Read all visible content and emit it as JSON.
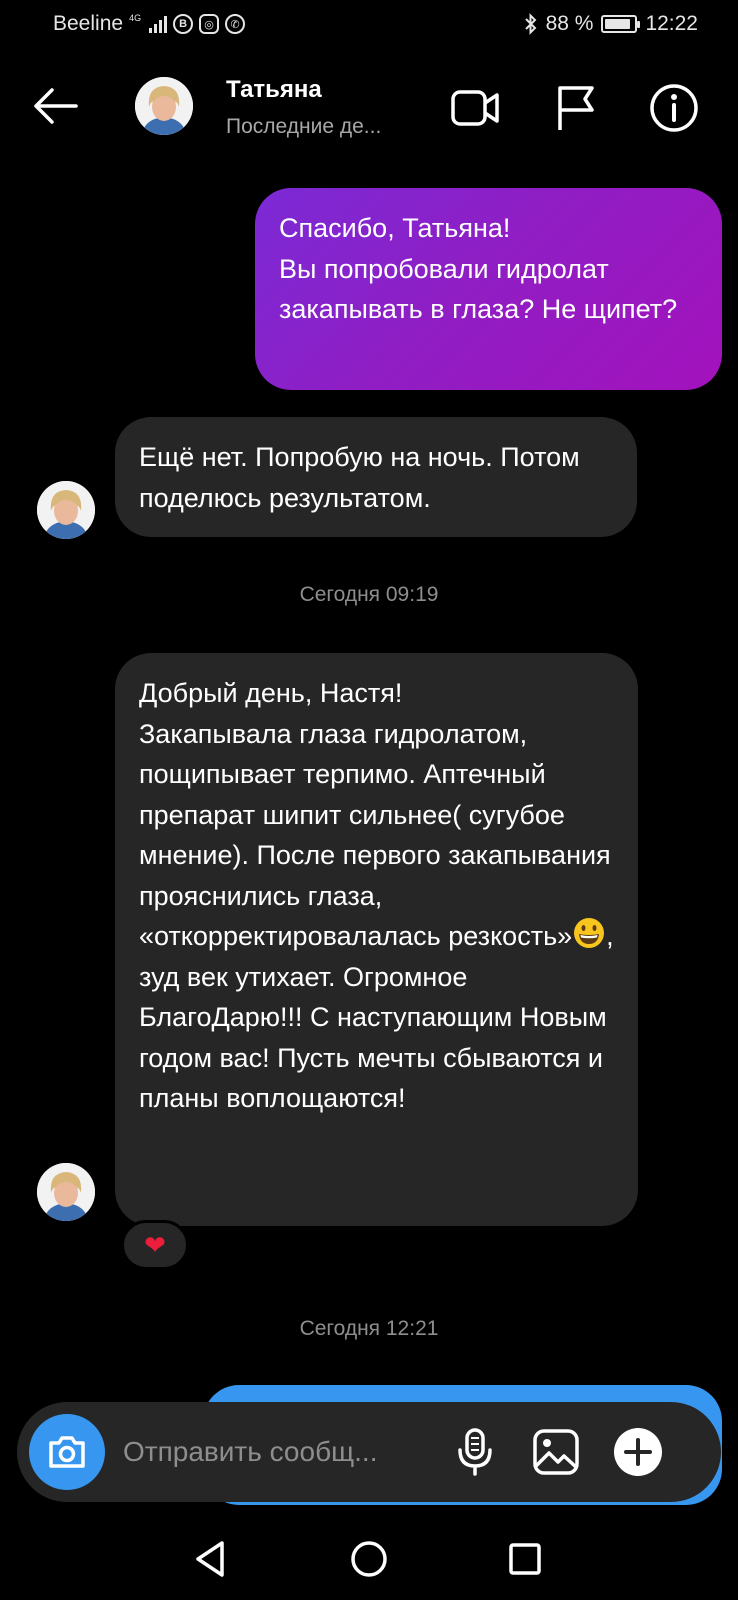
{
  "status_bar": {
    "carrier": "Beeline",
    "network": "4G",
    "app_badges": [
      "B",
      "◎",
      "✆"
    ],
    "bluetooth_icon": "bluetooth-icon",
    "battery_percent": "88 %",
    "battery_level": 0.88,
    "time": "12:22"
  },
  "header": {
    "back_icon": "arrow-left-icon",
    "contact_name": "Татьяна",
    "contact_status": "Последние де...",
    "video_icon": "video-camera-icon",
    "flag_icon": "flag-icon",
    "info_icon": "info-icon"
  },
  "messages": [
    {
      "direction": "outgoing",
      "text": "Спасибо, Татьяна!\nВы попробовали гидролат закапывать в глаза? Не щипет?"
    },
    {
      "direction": "incoming",
      "text": "Ещё нет. Попробую на ночь. Потом поделюсь результатом."
    },
    {
      "type": "timestamp",
      "text": "Сегодня 09:19"
    },
    {
      "direction": "incoming",
      "text_before_emoji": "Добрый день, Настя!\nЗакапывала глаза гидролатом, пощипывает терпимо.  Аптечный препарат шипит сильнее( сугубое мнение). После первого закапывания прояснились глаза, «откорректировалалась резкость»",
      "emoji": "grinning-face-emoji",
      "text_after_emoji": ", зуд век утихает. Огромное БлагоДарю!!! С наступающим Новым годом вас! Пусть мечты сбываются и планы воплощаются!",
      "reaction": "❤"
    },
    {
      "type": "timestamp",
      "text": "Сегодня 12:21"
    }
  ],
  "composer": {
    "camera_icon": "camera-icon",
    "placeholder": "Отправить сообщ...",
    "mic_icon": "microphone-icon",
    "gallery_icon": "image-icon",
    "plus_icon": "plus-circle-icon"
  },
  "nav_bar": {
    "back_icon": "triangle-back-icon",
    "home_icon": "circle-home-icon",
    "recents_icon": "square-recents-icon"
  },
  "colors": {
    "background": "#000000",
    "incoming_bubble": "#262626",
    "outgoing_gradient_start": "#7b2ad6",
    "outgoing_gradient_end": "#a312bc",
    "accent_blue": "#3797f0",
    "secondary_text": "#8e8e8e"
  }
}
